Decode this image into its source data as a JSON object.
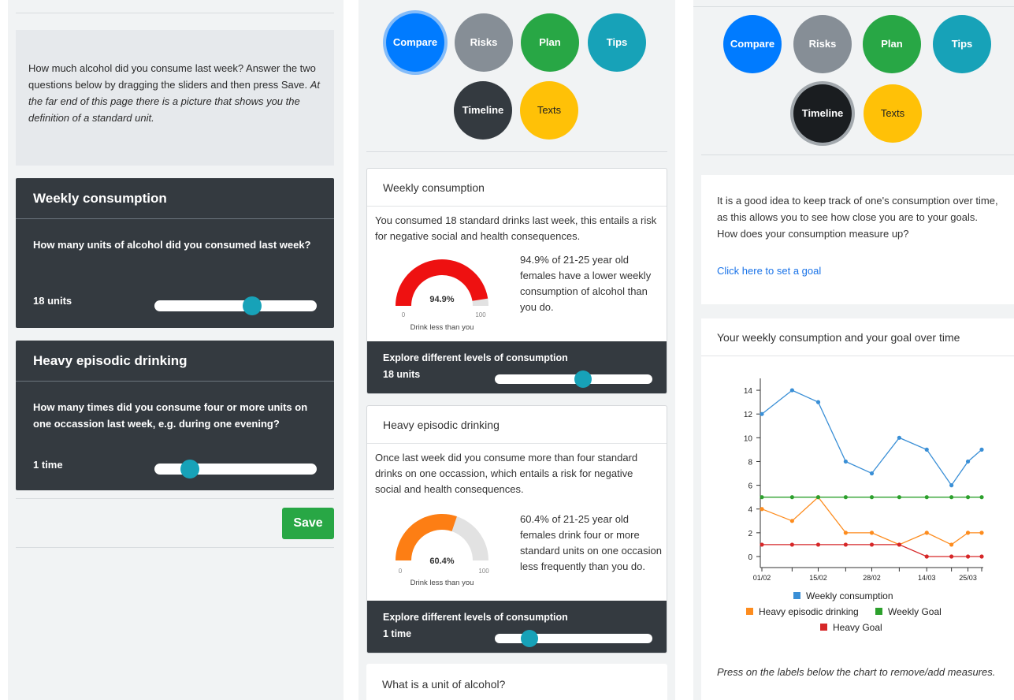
{
  "panel1": {
    "intro_text": "How much alcohol did you consume last week? Answer the two questions below by dragging the sliders and then press Save.",
    "intro_italic": "At the far end of this page there is a picture that shows you the definition of a standard unit.",
    "weekly": {
      "title": "Weekly consumption",
      "question": "How many units of alcohol did you consumed last week?",
      "value": "18 units",
      "slider_fraction": 0.6
    },
    "heavy": {
      "title": "Heavy episodic drinking",
      "question": "How many times did you consume four or more units on one occassion last week, e.g. during one evening?",
      "value": "1 time",
      "slider_fraction": 0.22
    },
    "save_label": "Save"
  },
  "nav": {
    "compare": "Compare",
    "risks": "Risks",
    "plan": "Plan",
    "tips": "Tips",
    "timeline": "Timeline",
    "texts": "Texts"
  },
  "panel2": {
    "weekly": {
      "title": "Weekly consumption",
      "text": "You consumed 18 standard drinks last week, this entails a risk for negative social and health consequences.",
      "gauge_percent": 94.9,
      "gauge_label": "94.9%",
      "gauge_min": "0",
      "gauge_max": "100",
      "gauge_caption": "Drink less than you",
      "gauge_color": "#ee1111",
      "note": "94.9% of 21-25 year old females have a lower weekly consumption of alcohol than you do.",
      "explore_label": "Explore different levels of consumption",
      "explore_value": "18 units",
      "slider_fraction": 0.56
    },
    "heavy": {
      "title": "Heavy episodic drinking",
      "text": "Once last week did you consume more than four standard drinks on one occassion, which entails a risk for negative social and health consequences.",
      "gauge_percent": 60.4,
      "gauge_label": "60.4%",
      "gauge_min": "0",
      "gauge_max": "100",
      "gauge_caption": "Drink less than you",
      "gauge_color": "#fd7e14",
      "note": "60.4% of 21-25 year old females drink four or more standard units on one occasion less frequently than you do.",
      "explore_label": "Explore different levels of consumption",
      "explore_value": "1 time",
      "slider_fraction": 0.22
    },
    "unit_title": "What is a unit of alcohol?"
  },
  "panel3": {
    "tip_text": "It is a good idea to keep track of one's consumption over time, as this allows you to see how close you are to your goals. How does your consumption measure up?",
    "goal_link": "Click here to set a goal",
    "chart_title": "Your weekly consumption and your goal over time",
    "footnote": "Press on the labels below the chart to remove/add measures."
  },
  "chart_data": {
    "type": "line",
    "title": "Your weekly consumption and your goal over time",
    "x_tick_labels": [
      "01/02",
      "15/02",
      "28/02",
      "14/03",
      "25/03"
    ],
    "ylim": [
      0,
      15
    ],
    "y_ticks": [
      0,
      2,
      4,
      6,
      8,
      10,
      12,
      14
    ],
    "grid": false,
    "legend_placement": "bottom",
    "series": [
      {
        "name": "Weekly consumption",
        "color": "#3a8fd6",
        "values": [
          12,
          14,
          13,
          8,
          7,
          10,
          9,
          6,
          8,
          9
        ]
      },
      {
        "name": "Heavy episodic drinking",
        "color": "#fd8c1e",
        "values": [
          4,
          3,
          5,
          2,
          2,
          1,
          2,
          1,
          2,
          2
        ]
      },
      {
        "name": "Weekly Goal",
        "color": "#2ca02c",
        "values": [
          5,
          5,
          5,
          5,
          5,
          5,
          5,
          5,
          5,
          5
        ]
      },
      {
        "name": "Heavy Goal",
        "color": "#d62728",
        "values": [
          1,
          1,
          1,
          1,
          1,
          1,
          0,
          0,
          0,
          0
        ]
      }
    ],
    "x_index_positions": [
      0,
      1.1,
      2.05,
      3.05,
      4.0,
      5.0,
      6.0,
      6.9,
      7.5,
      8.0
    ],
    "x_tick_index": [
      0,
      2.05,
      4.0,
      6.0,
      7.5
    ]
  }
}
